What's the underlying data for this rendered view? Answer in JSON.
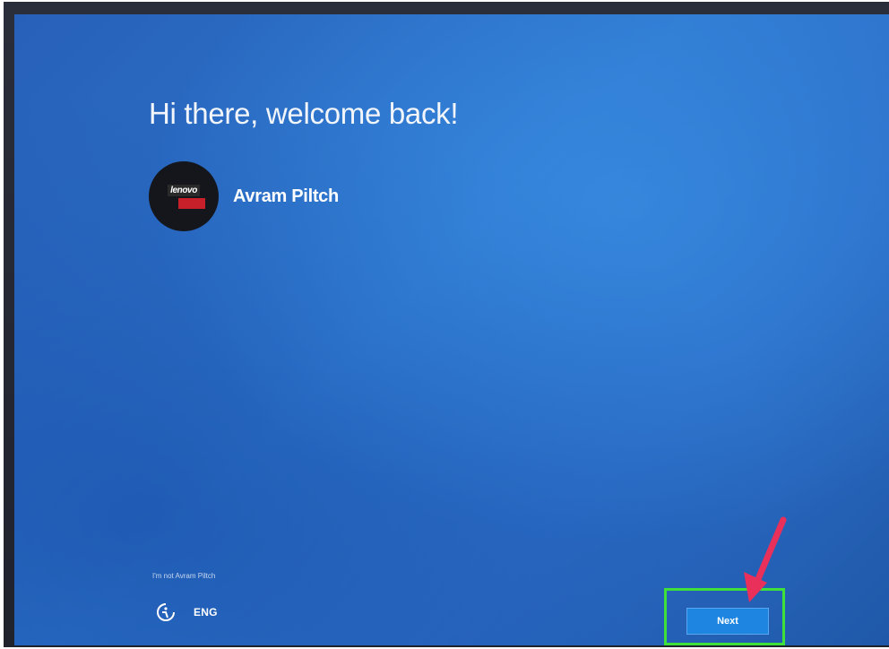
{
  "welcome": {
    "heading": "Hi there, welcome back!"
  },
  "account": {
    "name": "Avram Piltch",
    "avatar_logo_text": "lenovo"
  },
  "footer": {
    "not_user_link": "I'm not Avram Piltch",
    "language": "ENG",
    "next_label": "Next"
  },
  "colors": {
    "background": "#2b6cc6",
    "highlight_box": "#3fe03a",
    "arrow": "#e8305a",
    "button": "#1e86e0"
  }
}
